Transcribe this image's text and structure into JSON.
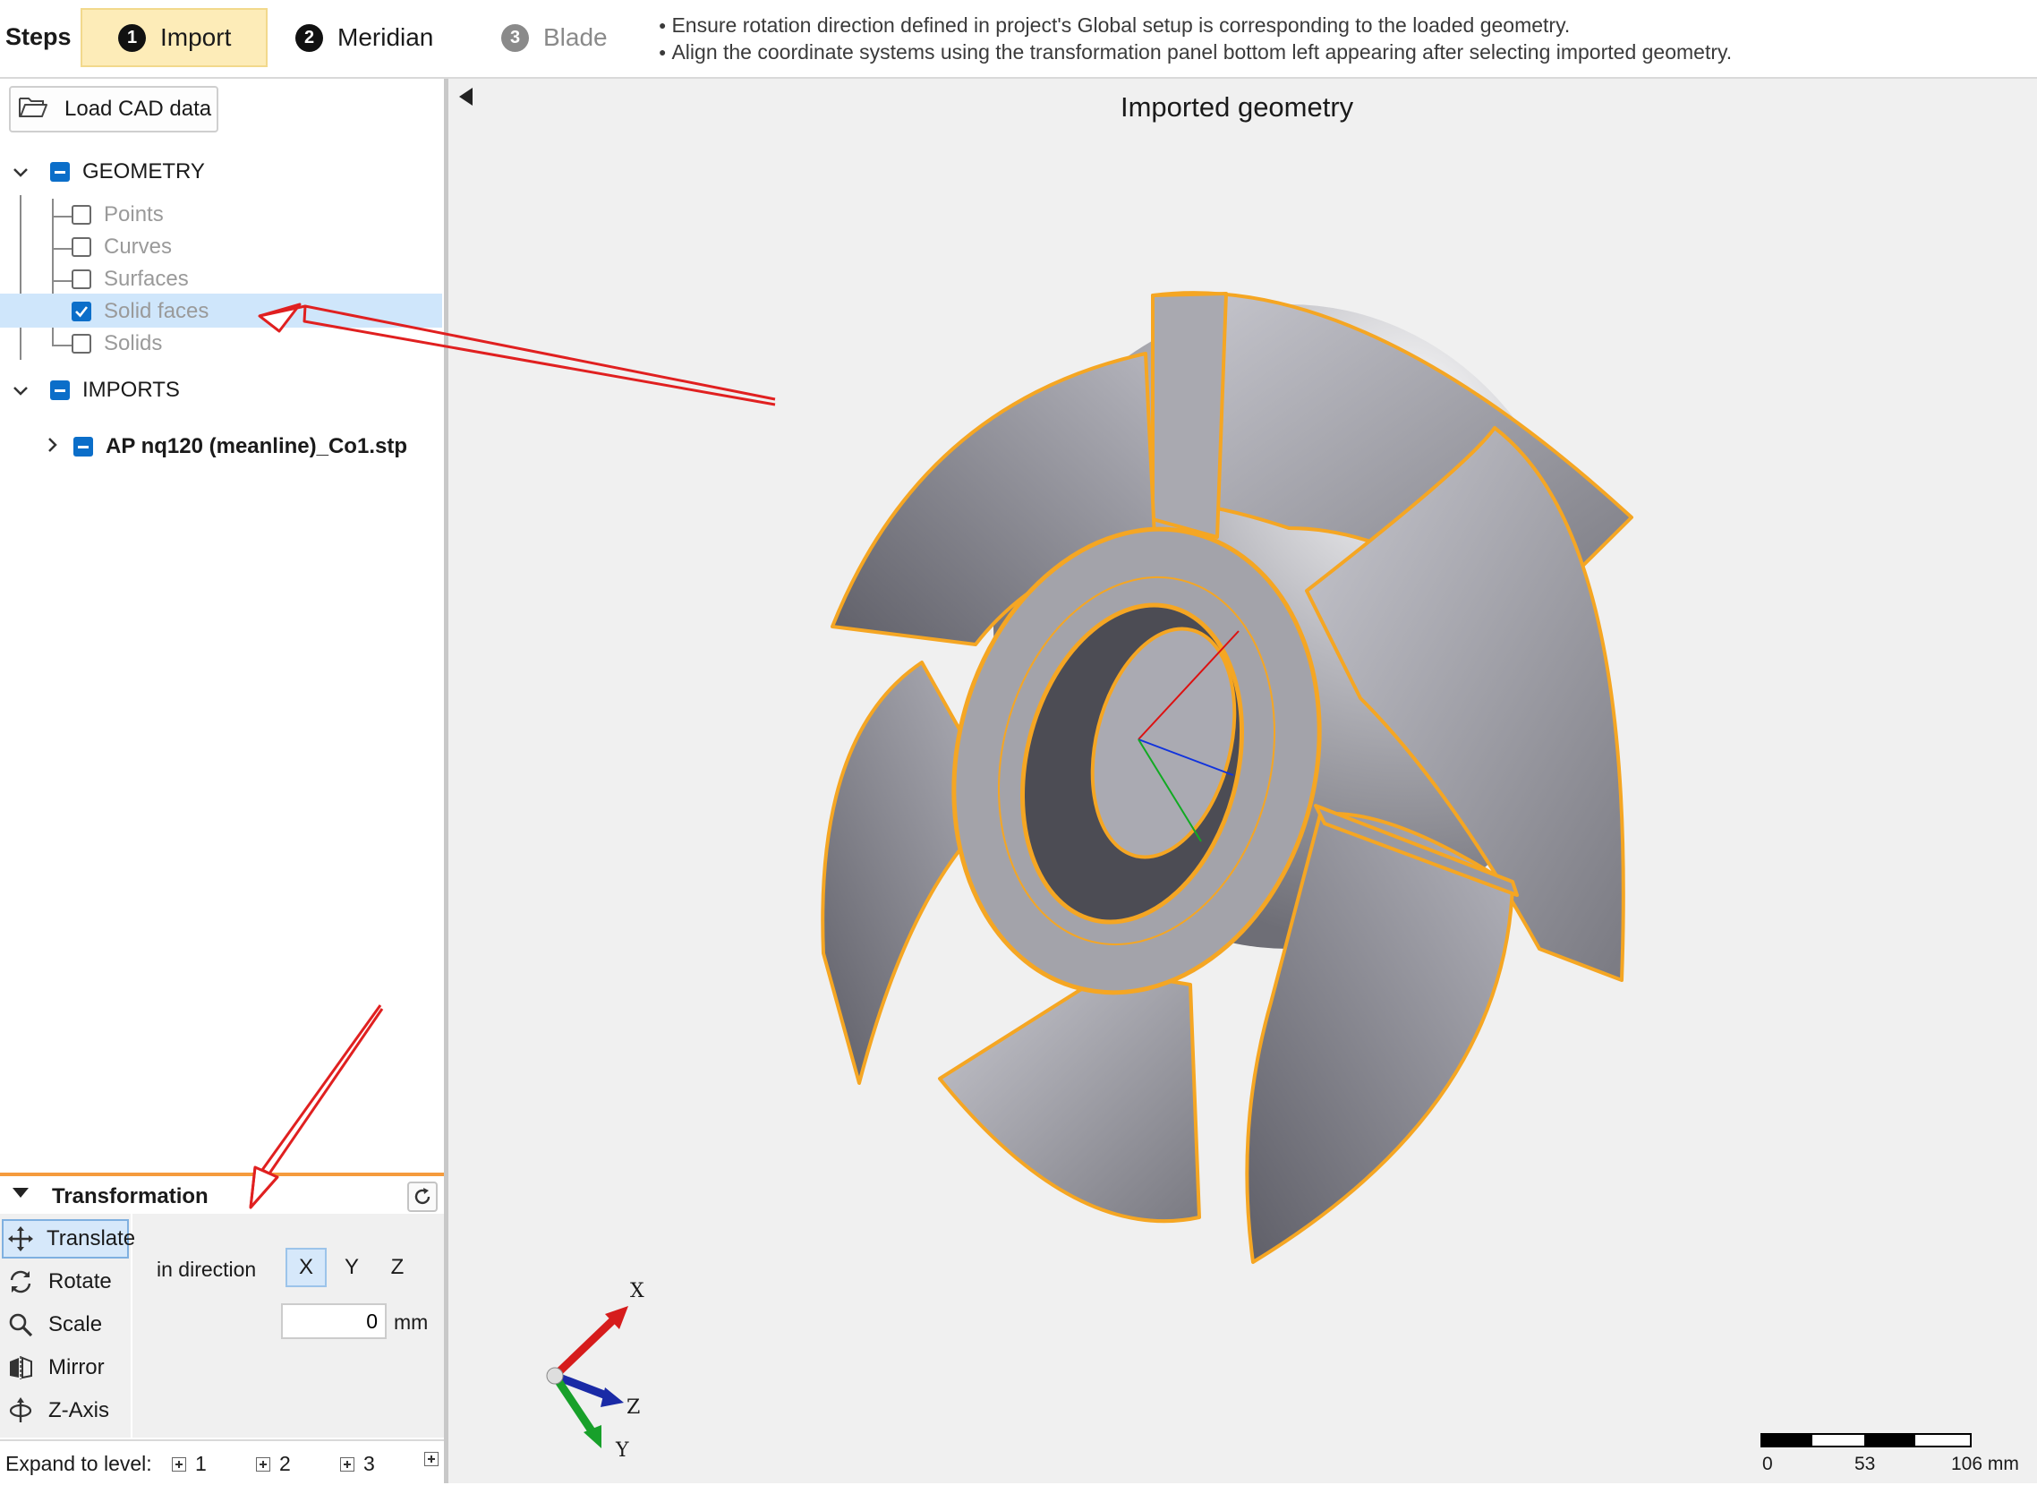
{
  "topbar": {
    "steps_label": "Steps",
    "steps": [
      {
        "number": "1",
        "label": "Import",
        "state": "active"
      },
      {
        "number": "2",
        "label": "Meridian",
        "state": "enabled"
      },
      {
        "number": "3",
        "label": "Blade",
        "state": "disabled"
      }
    ],
    "hints": [
      "Ensure rotation direction defined in project's Global setup is corresponding to the loaded geometry.",
      "Align the coordinate systems using the transformation panel bottom left appearing after selecting imported geometry."
    ]
  },
  "sidebar": {
    "load_button": "Load CAD data",
    "tree": {
      "geometry": {
        "label": "GEOMETRY",
        "children": [
          {
            "label": "Points",
            "checked": false
          },
          {
            "label": "Curves",
            "checked": false
          },
          {
            "label": "Surfaces",
            "checked": false
          },
          {
            "label": "Solid faces",
            "checked": true
          },
          {
            "label": "Solids",
            "checked": false
          }
        ]
      },
      "imports": {
        "label": "IMPORTS",
        "children": [
          {
            "label": "AP nq120 (meanline)_Co1.stp"
          }
        ]
      }
    }
  },
  "transformation": {
    "title": "Transformation",
    "tools": [
      "Translate",
      "Rotate",
      "Scale",
      "Mirror",
      "Z-Axis"
    ],
    "selected_tool": "Translate",
    "direction_label": "in direction",
    "axes": [
      "X",
      "Y",
      "Z"
    ],
    "selected_axis": "X",
    "amount_value": "0",
    "unit": "mm",
    "expand_label": "Expand to level:",
    "levels": [
      "1",
      "2",
      "3"
    ]
  },
  "viewport": {
    "title": "Imported geometry",
    "triad_labels": {
      "x": "X",
      "y": "Y",
      "z": "Z"
    },
    "scale_bar": [
      "0",
      "53",
      "106 mm"
    ]
  },
  "colors": {
    "accent_blue": "#0b6ec9",
    "active_step": "#fdecb8",
    "edge_orange": "#f5a623",
    "annotation_red": "#e02020"
  }
}
